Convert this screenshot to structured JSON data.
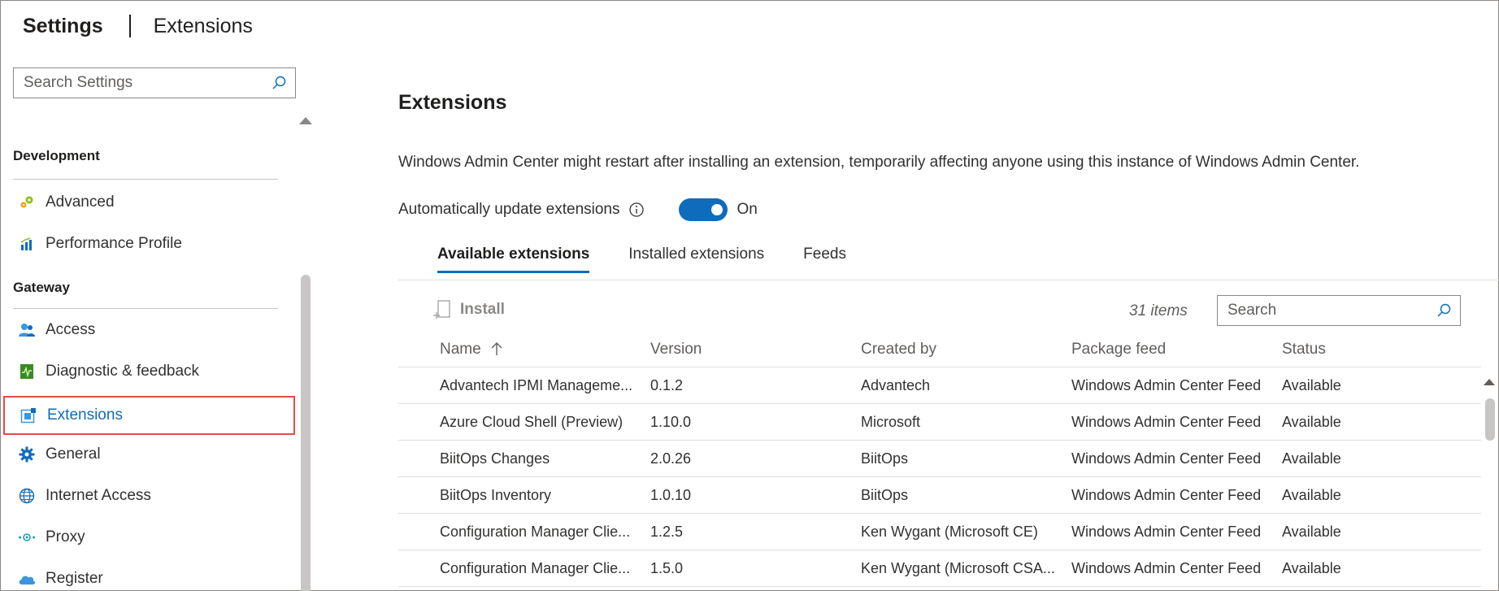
{
  "header": {
    "title": "Settings",
    "page": "Extensions"
  },
  "sidebar": {
    "search_placeholder": "Search Settings",
    "groups": [
      {
        "label": "Development"
      },
      {
        "label": "Gateway"
      }
    ],
    "items": [
      {
        "label": "Advanced",
        "icon": "gears-icon"
      },
      {
        "label": "Performance Profile",
        "icon": "bar-chart-icon"
      },
      {
        "label": "Access",
        "icon": "users-icon"
      },
      {
        "label": "Diagnostic & feedback",
        "icon": "diagnostic-icon"
      },
      {
        "label": "Extensions",
        "icon": "extensions-icon",
        "selected": true
      },
      {
        "label": "General",
        "icon": "gear-icon"
      },
      {
        "label": "Internet Access",
        "icon": "globe-icon"
      },
      {
        "label": "Proxy",
        "icon": "proxy-icon"
      },
      {
        "label": "Register",
        "icon": "cloud-icon"
      }
    ]
  },
  "main": {
    "title": "Extensions",
    "notice": "Windows Admin Center might restart after installing an extension, temporarily affecting anyone using this instance of Windows Admin Center.",
    "auto_update": {
      "label": "Automatically update extensions",
      "state": "On"
    },
    "tabs": [
      {
        "label": "Available extensions",
        "active": true
      },
      {
        "label": "Installed extensions"
      },
      {
        "label": "Feeds"
      }
    ],
    "toolbar": {
      "install_label": "Install",
      "item_count": "31 items",
      "search_placeholder": "Search"
    },
    "columns": [
      "Name",
      "Version",
      "Created by",
      "Package feed",
      "Status"
    ],
    "rows": [
      [
        "Advantech IPMI Manageme...",
        "0.1.2",
        "Advantech",
        "Windows Admin Center Feed",
        "Available"
      ],
      [
        "Azure Cloud Shell (Preview)",
        "1.10.0",
        "Microsoft",
        "Windows Admin Center Feed",
        "Available"
      ],
      [
        "BiitOps Changes",
        "2.0.26",
        "BiitOps",
        "Windows Admin Center Feed",
        "Available"
      ],
      [
        "BiitOps Inventory",
        "1.0.10",
        "BiitOps",
        "Windows Admin Center Feed",
        "Available"
      ],
      [
        "Configuration Manager Clie...",
        "1.2.5",
        "Ken Wygant (Microsoft CE)",
        "Windows Admin Center Feed",
        "Available"
      ],
      [
        "Configuration Manager Clie...",
        "1.5.0",
        "Ken Wygant (Microsoft CSA...",
        "Windows Admin Center Feed",
        "Available"
      ]
    ]
  },
  "colors": {
    "accent": "#0f6cbd",
    "selection_border": "#e74b45"
  }
}
